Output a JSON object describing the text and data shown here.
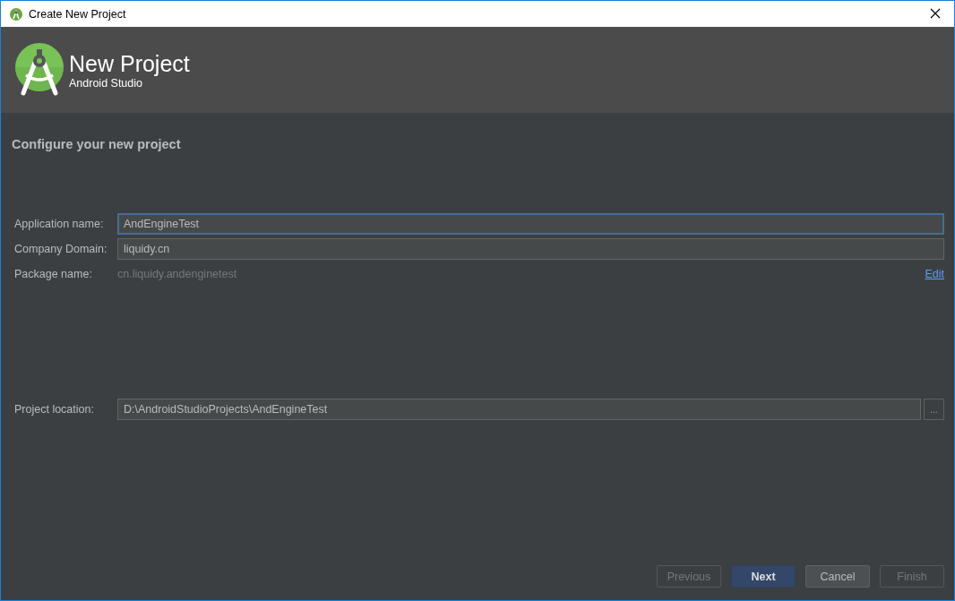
{
  "window": {
    "title": "Create New Project"
  },
  "header": {
    "title": "New Project",
    "subtitle": "Android Studio"
  },
  "section_title": "Configure your new project",
  "fields": [
    {
      "kind": "input",
      "label": "Application name:",
      "value": "AndEngineTest",
      "focused": true
    },
    {
      "kind": "input",
      "label": "Company Domain:",
      "value": "liquidy.cn",
      "focused": false
    },
    {
      "kind": "info",
      "label": "Package name:",
      "value": "cn.liquidy.andenginetest",
      "link": "Edit"
    }
  ],
  "location": {
    "label": "Project location:",
    "value": "D:\\AndroidStudioProjects\\AndEngineTest",
    "browse": "..."
  },
  "buttons": [
    {
      "label": "Previous",
      "disabled": true,
      "default": false
    },
    {
      "label": "Next",
      "disabled": false,
      "default": true
    },
    {
      "label": "Cancel",
      "disabled": false,
      "default": false
    },
    {
      "label": "Finish",
      "disabled": true,
      "default": false
    }
  ]
}
